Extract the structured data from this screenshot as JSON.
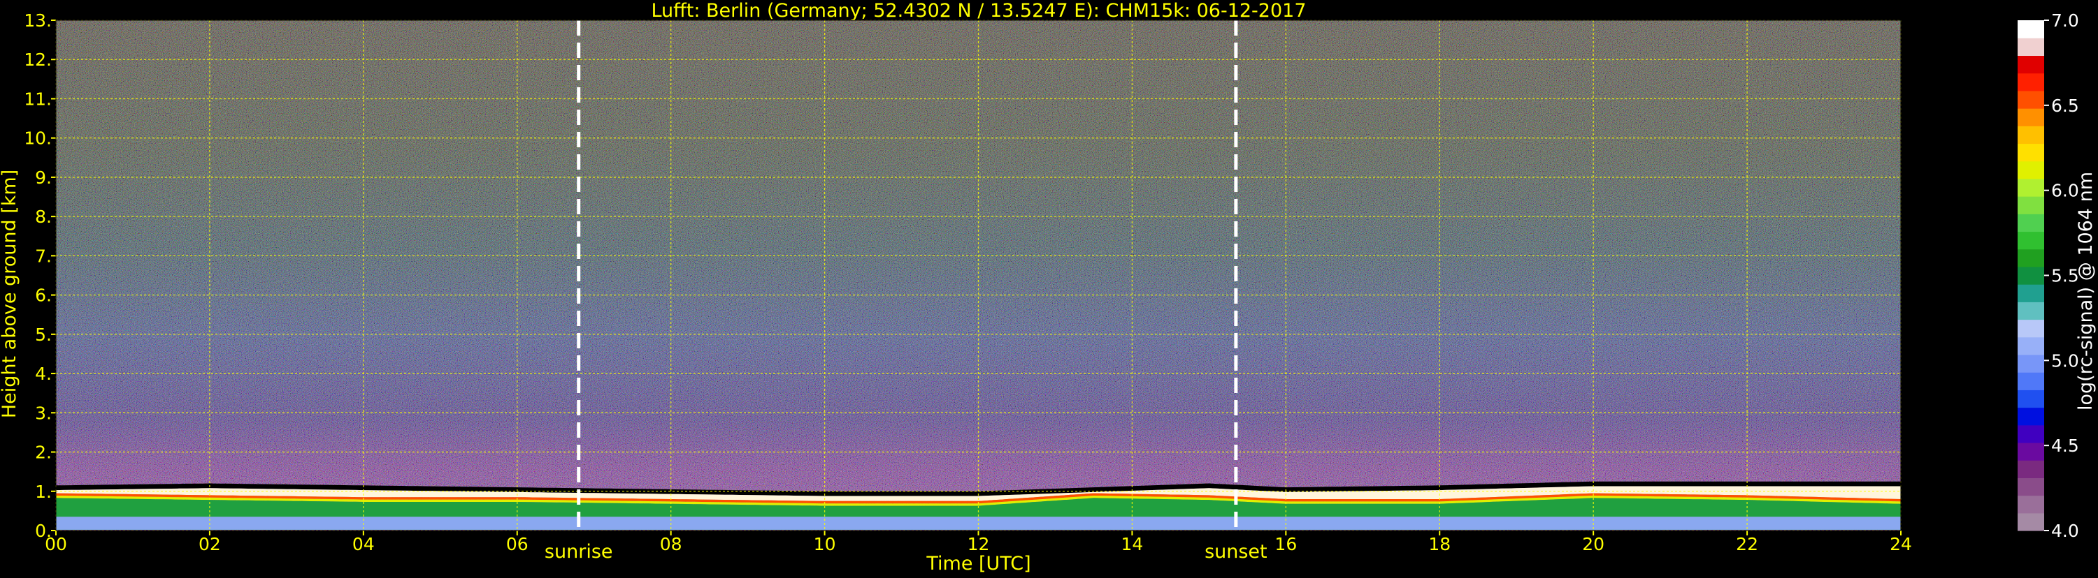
{
  "chart_data": {
    "type": "heatmap",
    "title": "Lufft: Berlin (Germany; 52.4302 N / 13.5247 E):    CHM15k: 06-12-2017",
    "xlabel": "Time [UTC]",
    "ylabel": "Height above ground [km]",
    "xlim": [
      0,
      24
    ],
    "ylim": [
      0,
      13
    ],
    "x_ticks": [
      "00",
      "02",
      "04",
      "06",
      "08",
      "10",
      "12",
      "14",
      "16",
      "18",
      "20",
      "22",
      "24"
    ],
    "y_ticks": [
      "0.",
      "1.",
      "2.",
      "3.",
      "4.",
      "5.",
      "6.",
      "7.",
      "8.",
      "9.",
      "10.",
      "11.",
      "12.",
      "13."
    ],
    "grid": true,
    "colorbar": {
      "label": "log(rc-signal) @ 1064 nm",
      "range": [
        4.0,
        7.0
      ],
      "ticks": [
        "4.0",
        "4.5",
        "5.0",
        "5.5",
        "6.0",
        "6.5",
        "7.0"
      ],
      "colors": [
        "#a58aa5",
        "#9a6f9a",
        "#8a4c8a",
        "#7a2a80",
        "#6a0aa0",
        "#4000c0",
        "#0010e0",
        "#2050f0",
        "#5078f8",
        "#7896f8",
        "#98b0f8",
        "#b8c8f8",
        "#60c0c0",
        "#20a090",
        "#109040",
        "#20a020",
        "#30c030",
        "#50d050",
        "#80e040",
        "#b0f030",
        "#e0f000",
        "#ffe000",
        "#ffc000",
        "#ff9000",
        "#ff5000",
        "#ff2000",
        "#e00000",
        "#f0d0d0",
        "#ffffff"
      ]
    },
    "events": [
      {
        "label": "sunrise",
        "x": 6.8
      },
      {
        "label": "sunset",
        "x": 15.35
      }
    ],
    "layers": {
      "boundary_layer_top_km": [
        [
          0,
          1.1
        ],
        [
          2,
          1.15
        ],
        [
          4,
          1.1
        ],
        [
          6,
          1.05
        ],
        [
          8,
          1.0
        ],
        [
          10,
          0.95
        ],
        [
          12,
          0.95
        ],
        [
          13.5,
          1.05
        ],
        [
          15,
          1.15
        ],
        [
          16,
          1.05
        ],
        [
          18,
          1.1
        ],
        [
          20,
          1.2
        ],
        [
          22,
          1.2
        ],
        [
          24,
          1.2
        ]
      ],
      "dense_layer_top_km": [
        [
          0,
          0.95
        ],
        [
          2,
          0.9
        ],
        [
          4,
          0.85
        ],
        [
          6,
          0.85
        ],
        [
          8,
          0.8
        ],
        [
          10,
          0.75
        ],
        [
          12,
          0.75
        ],
        [
          13.5,
          0.95
        ],
        [
          15,
          0.9
        ],
        [
          16,
          0.8
        ],
        [
          18,
          0.8
        ],
        [
          20,
          0.95
        ],
        [
          22,
          0.9
        ],
        [
          24,
          0.8
        ]
      ]
    }
  }
}
